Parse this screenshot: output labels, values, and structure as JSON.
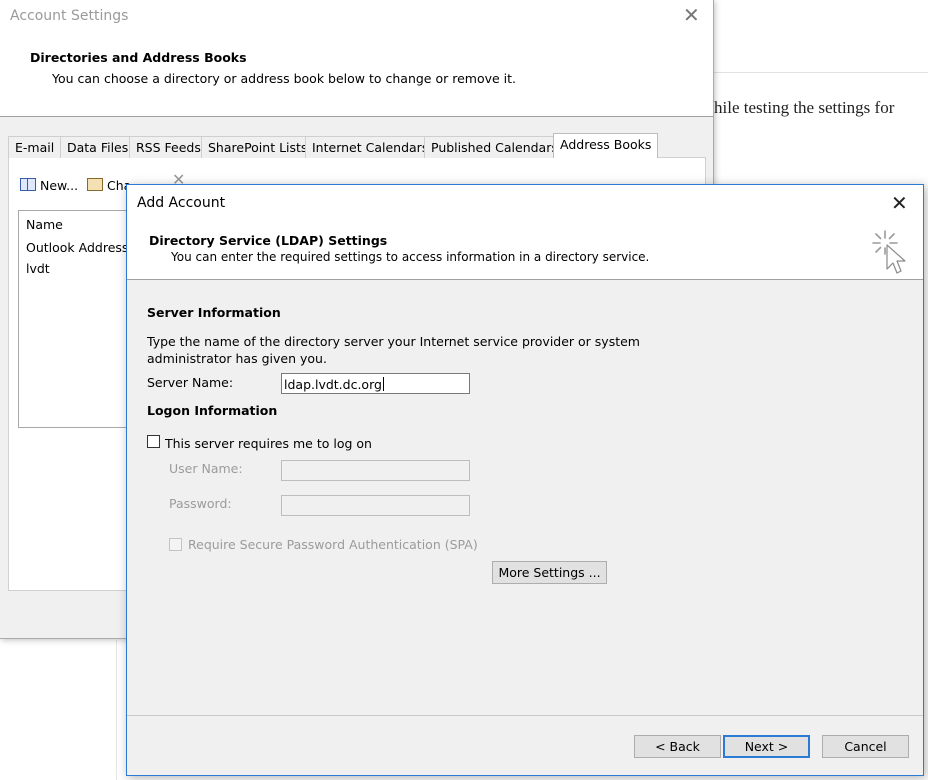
{
  "document": {
    "text_fragment": "hile testing the settings for"
  },
  "account_settings": {
    "title": "Account Settings",
    "close_glyph": "✕",
    "header_title": "Directories and Address Books",
    "header_subtitle": "You can choose a directory or address book below to change or remove it.",
    "tabs": [
      {
        "label": "E-mail"
      },
      {
        "label": "Data Files"
      },
      {
        "label": "RSS Feeds"
      },
      {
        "label": "SharePoint Lists"
      },
      {
        "label": "Internet Calendars"
      },
      {
        "label": "Published Calendars"
      },
      {
        "label": "Address Books"
      }
    ],
    "active_tab": "Address Books",
    "toolbar": {
      "new_label": "New...",
      "change_label": "Cha",
      "delete_glyph": "✕"
    },
    "list": {
      "column_header": "Name",
      "items": [
        {
          "label": "Outlook Address"
        },
        {
          "label": "lvdt"
        }
      ]
    }
  },
  "add_account": {
    "title": "Add Account",
    "close_glyph": "✕",
    "header_title": "Directory Service (LDAP) Settings",
    "header_subtitle": "You can enter the required settings to access information in a directory service.",
    "server_section_title": "Server Information",
    "server_description_line1": "Type the name of the directory server your Internet service provider or system",
    "server_description_line2": "administrator has given you.",
    "server_name_label": "Server Name:",
    "server_name_value": "ldap.lvdt.dc.org",
    "logon_section_title": "Logon Information",
    "requires_logon_label": "This server requires me to log on",
    "requires_logon_checked": false,
    "user_name_label": "User Name:",
    "user_name_value": "",
    "password_label": "Password:",
    "password_value": "",
    "spa_label": "Require Secure Password Authentication (SPA)",
    "more_settings_label": "More Settings ...",
    "back_label": "< Back",
    "next_label": "Next >",
    "cancel_label": "Cancel"
  },
  "colors": {
    "dialog_border": "#2b7bd4",
    "window_bg": "#f0f0f0",
    "disabled_text": "#9b9b9b"
  }
}
